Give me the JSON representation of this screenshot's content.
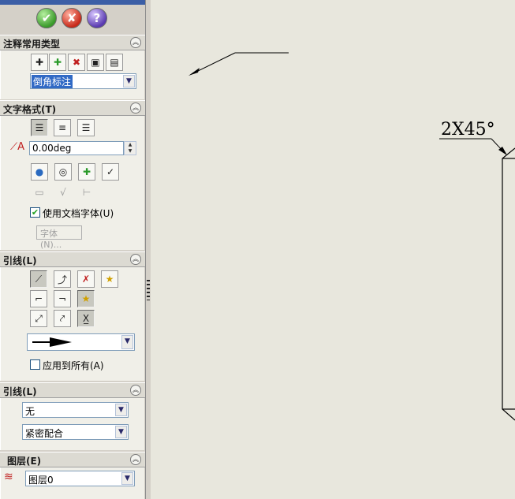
{
  "app": {
    "accent": "#3b5ea6",
    "canvas_bg": "#e8e7dd",
    "panel_bg": "#d4d0c8"
  },
  "okbar": {
    "ok_icon": "check-icon",
    "cancel_icon": "x-icon",
    "help_icon": "question-icon",
    "help_label": "?"
  },
  "sections": {
    "annotation_types": {
      "title": "注释常用类型",
      "tools": [
        "add-style-icon",
        "add-icon",
        "delete-icon",
        "save-icon",
        "load-icon"
      ],
      "selected_type": "倒角标注"
    },
    "text_format": {
      "title": "文字格式(T)",
      "angle_value": "0.00deg",
      "use_doc_font_label": "使用文档字体(U)",
      "use_doc_font_checked": true,
      "font_button_label": "字体(N)..."
    },
    "leader": {
      "title": "引线(L)",
      "arrow_style": "solid-arrow",
      "apply_all_label": "应用到所有(A)",
      "apply_all_checked": false
    },
    "leader2": {
      "title": "引线(L)",
      "option1": "无",
      "option2": "紧密配合"
    },
    "layer": {
      "title": "图层(E)",
      "value": "图层0"
    }
  },
  "drawing": {
    "chamfer_label": "2X45°"
  }
}
